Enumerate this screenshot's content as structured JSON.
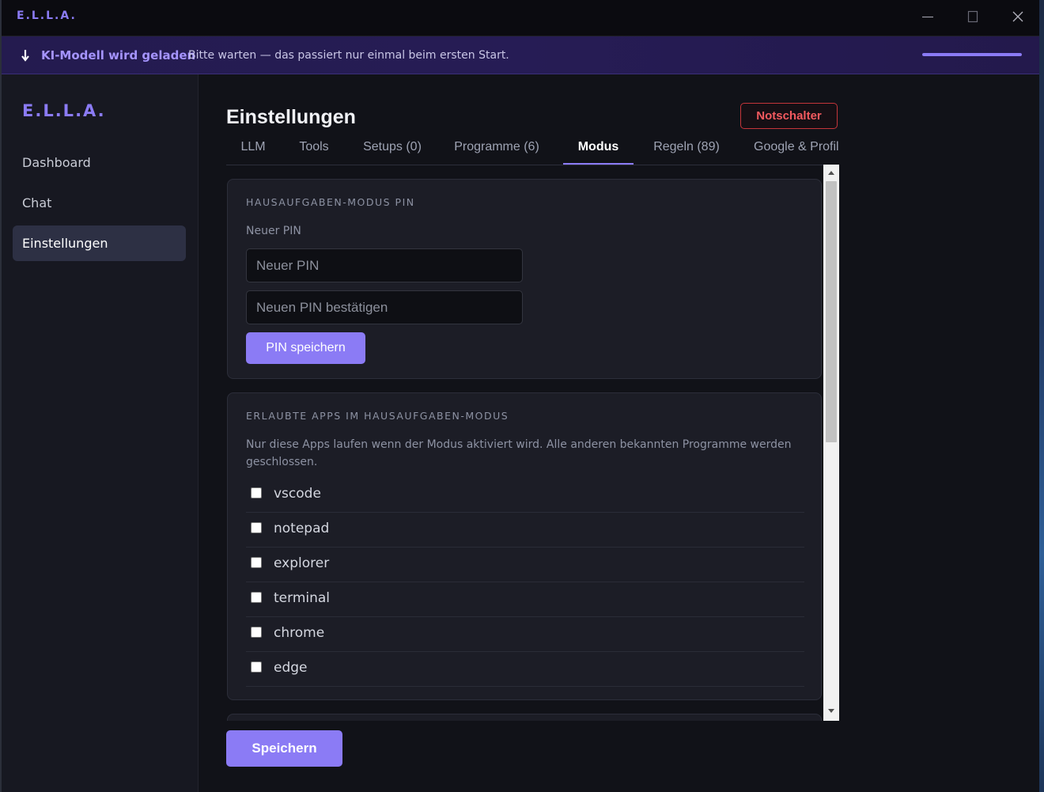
{
  "window": {
    "title": "E.L.L.A.",
    "controls": [
      "minimize-icon",
      "maximize-icon",
      "close-icon"
    ]
  },
  "banner": {
    "icon": "download-arrow-icon",
    "title": "KI-Modell wird geladen",
    "text": "Bitte warten — das passiert nur einmal beim ersten Start.",
    "progress": 1.0
  },
  "sidebar": {
    "logo": "E.L.L.A.",
    "items": [
      {
        "label": "Dashboard"
      },
      {
        "label": "Chat"
      },
      {
        "label": "Einstellungen",
        "active": true
      }
    ]
  },
  "main": {
    "title": "Einstellungen",
    "kill_switch_label": "Notschalter",
    "tabs": [
      {
        "label": "LLM"
      },
      {
        "label": "Tools"
      },
      {
        "label": "Setups (0)"
      },
      {
        "label": "Programme (6)"
      },
      {
        "label": "Modus",
        "active": true
      },
      {
        "label": "Regeln (89)"
      },
      {
        "label": "Google & Profil"
      }
    ],
    "pin_card": {
      "heading": "HAUSAUFGABEN-MODUS PIN",
      "field_label": "Neuer PIN",
      "new_pin_placeholder": "Neuer PIN",
      "new_pin_value": "",
      "confirm_placeholder": "Neuen PIN bestätigen",
      "confirm_value": "",
      "save_label": "PIN speichern"
    },
    "apps_card": {
      "heading": "ERLAUBTE APPS IM HAUSAUFGABEN-MODUS",
      "description": "Nur diese Apps laufen wenn der Modus aktiviert wird. Alle anderen bekannten Programme werden geschlossen.",
      "apps": [
        {
          "name": "vscode",
          "checked": false
        },
        {
          "name": "notepad",
          "checked": false
        },
        {
          "name": "explorer",
          "checked": false
        },
        {
          "name": "terminal",
          "checked": false
        },
        {
          "name": "chrome",
          "checked": false
        },
        {
          "name": "edge",
          "checked": false
        }
      ]
    },
    "save_label": "Speichern"
  },
  "colors": {
    "accent": "#8b7bf5",
    "danger": "#f35a5f",
    "background": "#111218",
    "sidebar": "#171821",
    "card": "#1c1d26"
  }
}
